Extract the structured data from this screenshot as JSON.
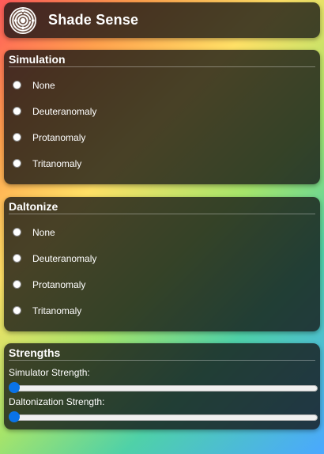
{
  "app": {
    "title": "Shade Sense",
    "logo_icon": "concentric-maze-icon"
  },
  "simulation": {
    "title": "Simulation",
    "options": [
      "None",
      "Deuteranomaly",
      "Protanomaly",
      "Tritanomaly"
    ]
  },
  "daltonize": {
    "title": "Daltonize",
    "options": [
      "None",
      "Deuteranomaly",
      "Protanomaly",
      "Tritanomaly"
    ]
  },
  "strengths": {
    "title": "Strengths",
    "simulator_label": "Simulator Strength:",
    "simulator_value": 0,
    "daltonization_label": "Daltonization Strength:",
    "daltonization_value": 0
  },
  "colors": {
    "accent": "#0a73e8"
  }
}
